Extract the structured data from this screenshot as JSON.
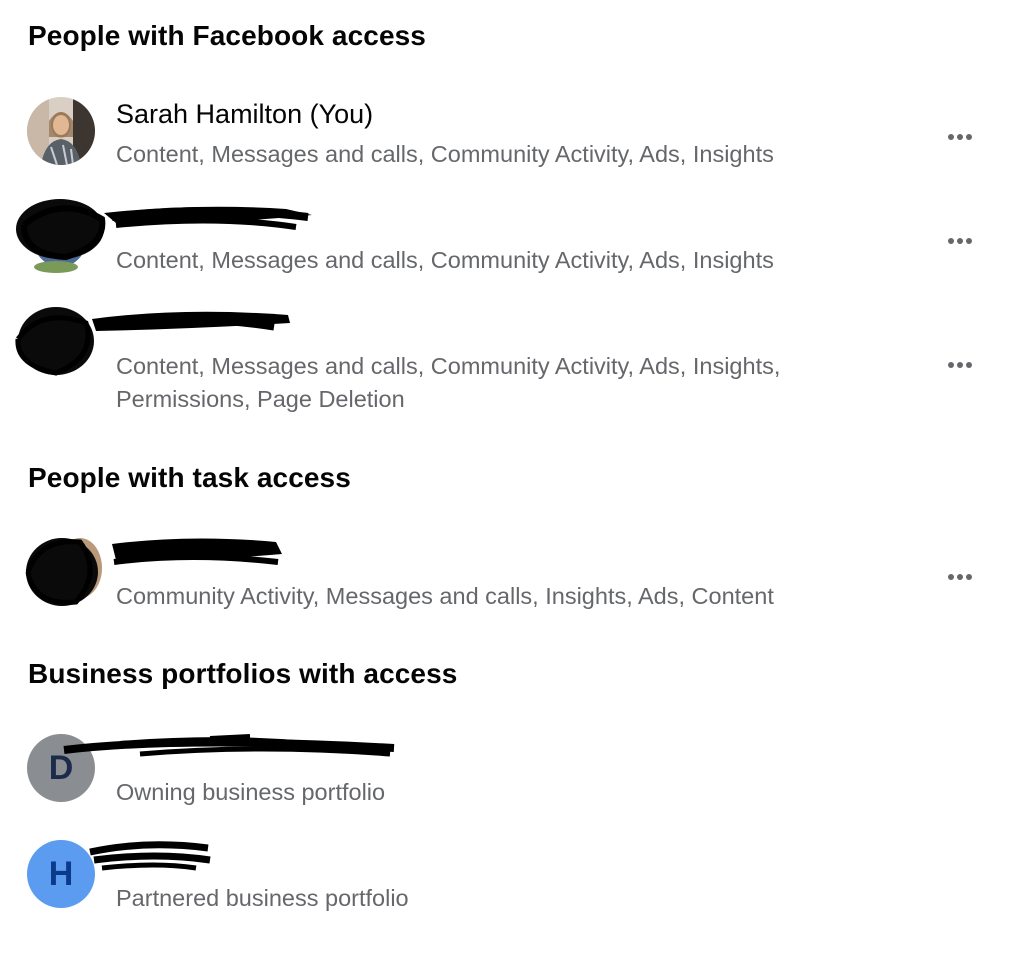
{
  "sections": {
    "facebook_access": {
      "title": "People with Facebook access",
      "people": [
        {
          "name": "Sarah Hamilton (You)",
          "access": "Content, Messages and calls, Community Activity, Ads, Insights"
        },
        {
          "name": "",
          "access": "Content, Messages and calls, Community Activity, Ads, Insights"
        },
        {
          "name": "",
          "access_line1": "Content, Messages and calls, Community Activity, Ads, Insights,",
          "access_line2": "Permissions, Page Deletion"
        }
      ]
    },
    "task_access": {
      "title": "People with task access",
      "people": [
        {
          "name": "",
          "access": "Community Activity, Messages and calls, Insights, Ads, Content"
        }
      ]
    },
    "business_portfolios": {
      "title": "Business portfolios with access",
      "portfolios": [
        {
          "initial": "D",
          "type": "Owning business portfolio",
          "avatar_color": "#8a8d91",
          "initial_color": "#1c2b4a"
        },
        {
          "initial": "H",
          "type": "Partnered business portfolio",
          "avatar_color": "#5b9bf0",
          "initial_color": "#0b3a8c"
        }
      ]
    }
  },
  "icons": {
    "more": "more-options-icon",
    "redaction": "redaction-scribble"
  }
}
